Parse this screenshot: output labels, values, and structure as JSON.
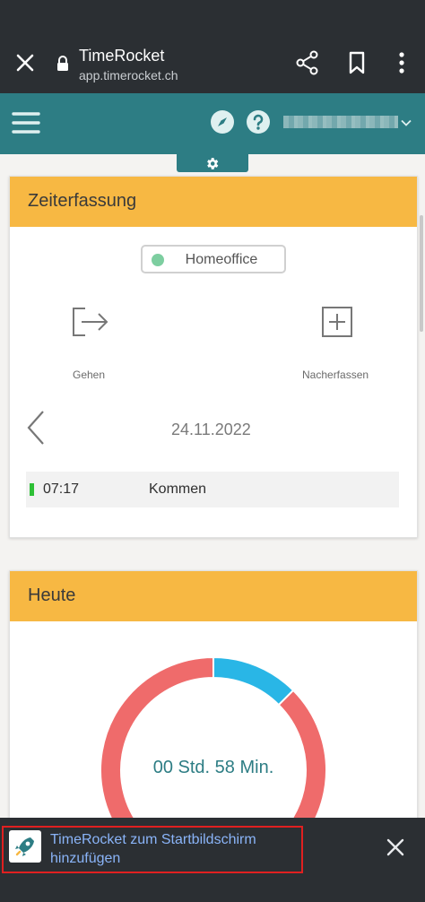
{
  "browser": {
    "title": "TimeRocket",
    "url": "app.timerocket.ch",
    "icons": [
      "close-icon",
      "lock-icon",
      "share-icon",
      "bookmark-icon",
      "more-vert-icon"
    ]
  },
  "header": {
    "icons": [
      "menu-icon",
      "compass-icon",
      "help-icon",
      "chevron-down-icon",
      "gear-icon"
    ]
  },
  "zeiterfassung": {
    "title": "Zeiterfassung",
    "status_label": "Homeoffice",
    "status_color": "#7dcea0",
    "gehen_label": "Gehen",
    "nacherfassen_label": "Nacherfassen",
    "date": "24.11.2022",
    "entries": [
      {
        "time": "07:17",
        "type": "Kommen",
        "marker_color": "#2ec036"
      }
    ]
  },
  "heute": {
    "title": "Heute",
    "duration": "00 Std. 58 Min.",
    "chart_data": {
      "type": "pie",
      "series": [
        {
          "value": 0.125,
          "color": "#29b6e6"
        },
        {
          "value": 0.875,
          "color": "#ef6b6b"
        }
      ]
    }
  },
  "banner": {
    "text": "TimeRocket zum Startbildschirm hinzufügen"
  },
  "colors": {
    "accent": "#2d7d84",
    "card_header": "#f7b843",
    "chrome": "#2b2f33"
  }
}
